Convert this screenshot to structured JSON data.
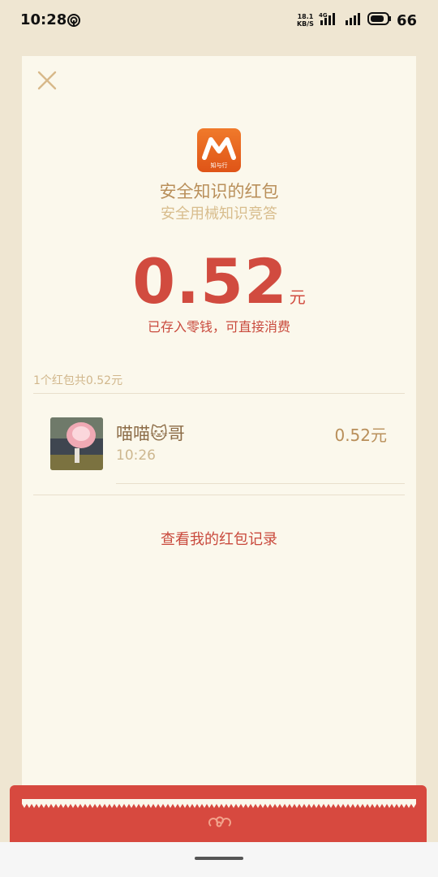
{
  "status_bar": {
    "time": "10:28",
    "net_speed_value": "18.1",
    "net_speed_unit": "KB/S",
    "network_type": "4G",
    "battery": "66"
  },
  "packet": {
    "logo_text": "知与行",
    "title": "安全知识的红包",
    "subtitle": "安全用械知识竞答",
    "amount": "0.52",
    "unit": "元",
    "note": "已存入零钱，可直接消费"
  },
  "summary": "1个红包共0.52元",
  "records": [
    {
      "name": "喵喵🐱哥",
      "time": "10:26",
      "amount": "0.52元"
    }
  ],
  "history_link": "查看我的红包记录",
  "colors": {
    "accent_red": "#d14b3f",
    "gold": "#b98f5a",
    "card_bg": "#fbf8ec",
    "page_bg": "#efe6d2"
  }
}
